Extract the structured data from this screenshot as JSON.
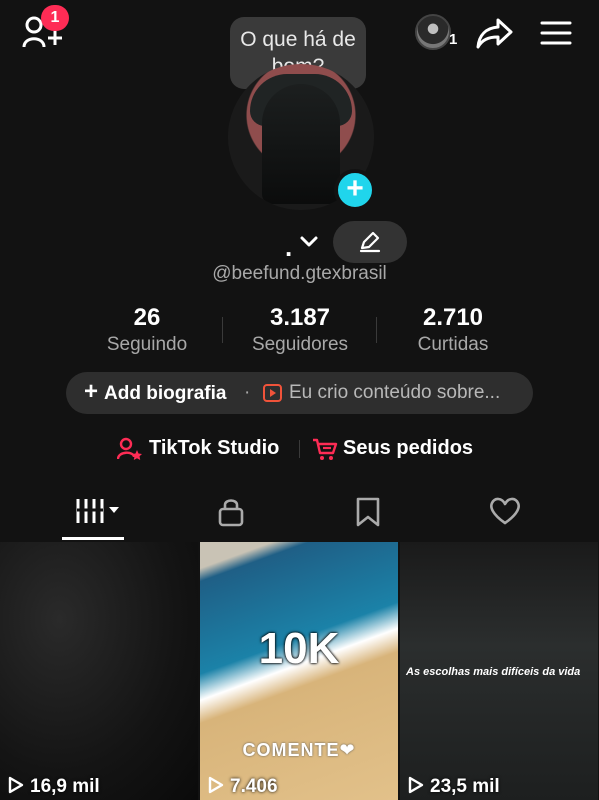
{
  "header": {
    "notification_count": "1",
    "tooltip": "O que há de bom?",
    "account_count": "1",
    "icons": [
      "add-friend-icon",
      "share-icon",
      "menu-icon"
    ]
  },
  "profile": {
    "display_name": ".",
    "username": "@beefund.gtexbrasil",
    "stats": [
      {
        "value": "26",
        "label": "Seguindo"
      },
      {
        "value": "3.187",
        "label": "Seguidores"
      },
      {
        "value": "2.710",
        "label": "Curtidas"
      }
    ]
  },
  "bio": {
    "add_label": "Add biografia",
    "separator": "·",
    "preview": "Eu crio conteúdo sobre..."
  },
  "links": {
    "studio_label": "TikTok Studio",
    "orders_label": "Seus pedidos"
  },
  "tabs": [
    "videos",
    "private",
    "saved",
    "liked"
  ],
  "videos": [
    {
      "views": "16,9 mil",
      "overlay": "",
      "sub": "",
      "caption": ""
    },
    {
      "views": "7.406",
      "overlay": "10K",
      "sub": "COMENTE❤",
      "caption": ""
    },
    {
      "views": "23,5 mil",
      "overlay": "",
      "sub": "",
      "caption": "As escolhas mais difíceis da vida"
    }
  ],
  "colors": {
    "accent": "#fe2c55",
    "plus": "#20d5ec",
    "background": "#121212"
  }
}
